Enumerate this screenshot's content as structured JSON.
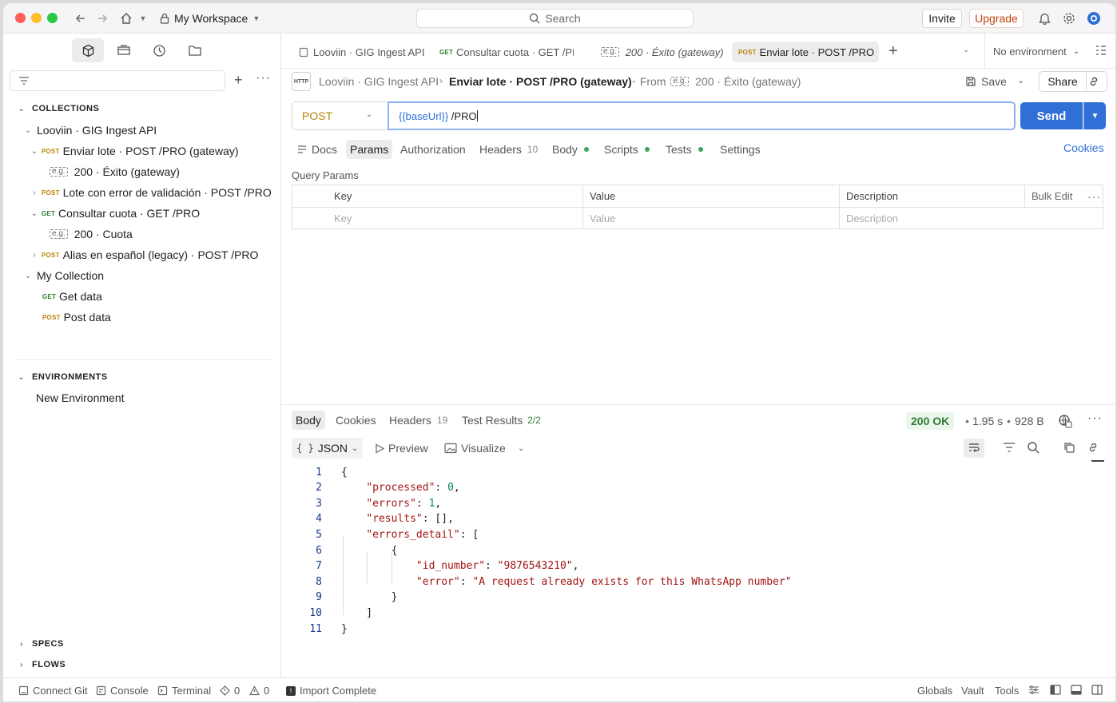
{
  "titlebar": {
    "workspace": "My Workspace",
    "search_placeholder": "Search",
    "invite_label": "Invite",
    "upgrade_label": "Upgrade"
  },
  "sidebar": {
    "collections_heading": "COLLECTIONS",
    "environments_heading": "ENVIRONMENTS",
    "specs_heading": "SPECS",
    "flows_heading": "FLOWS",
    "tree": [
      {
        "label": "Looviin · GIG Ingest API",
        "method": "",
        "kind": "collection"
      },
      {
        "label": "Enviar lote · POST /PRO (gateway)",
        "method": "POST",
        "kind": "request"
      },
      {
        "label": "200 · Éxito (gateway)",
        "method": "",
        "kind": "example"
      },
      {
        "label": "Lote con error de validación · POST /PRO",
        "method": "POST",
        "kind": "request"
      },
      {
        "label": "Consultar cuota · GET /PRO",
        "method": "GET",
        "kind": "request"
      },
      {
        "label": "200 · Cuota",
        "method": "",
        "kind": "example"
      },
      {
        "label": "Alias en español (legacy) · POST /PRO",
        "method": "POST",
        "kind": "request"
      },
      {
        "label": "My Collection",
        "method": "",
        "kind": "collection"
      },
      {
        "label": "Get data",
        "method": "GET",
        "kind": "request"
      },
      {
        "label": "Post data",
        "method": "POST",
        "kind": "request"
      }
    ],
    "environments": [
      "New Environment"
    ]
  },
  "tabs": [
    {
      "label": "Looviin · GIG Ingest API",
      "method": ""
    },
    {
      "label": "Consultar cuota · GET /PI",
      "method": "GET"
    },
    {
      "label": "200 · Éxito (gateway)",
      "method": ""
    },
    {
      "label": "Enviar lote · POST /PRO",
      "method": "POST"
    }
  ],
  "environment_selector": "No environment",
  "request": {
    "breadcrumb_collection": "Looviin · GIG Ingest API",
    "breadcrumb_request": "Enviar lote · POST /PRO (gateway)",
    "from_label": "From",
    "from_example": "200 · Éxito (gateway)",
    "save_label": "Save",
    "share_label": "Share",
    "method": "POST",
    "url_var": "{{baseUrl}}",
    "url_path": " /PRO",
    "send_label": "Send",
    "tabs": [
      {
        "label": "Docs"
      },
      {
        "label": "Params"
      },
      {
        "label": "Authorization"
      },
      {
        "label": "Headers",
        "count": "10"
      },
      {
        "label": "Body"
      },
      {
        "label": "Scripts"
      },
      {
        "label": "Tests"
      },
      {
        "label": "Settings"
      }
    ],
    "cookies_label": "Cookies",
    "query_params_title": "Query Params",
    "params_table": {
      "headers": [
        "Key",
        "Value",
        "Description"
      ],
      "bulk_edit": "Bulk Edit",
      "placeholders": [
        "Key",
        "Value",
        "Description"
      ]
    }
  },
  "response": {
    "tabs": [
      {
        "label": "Body"
      },
      {
        "label": "Cookies"
      },
      {
        "label": "Headers",
        "count": "19"
      },
      {
        "label": "Test Results",
        "count": "2/2"
      }
    ],
    "status": "200 OK",
    "time": "1.95 s",
    "size": "928 B",
    "format": "JSON",
    "preview_label": "Preview",
    "visualize_label": "Visualize",
    "code_lines": [
      "{",
      "    \"processed\": 0,",
      "    \"errors\": 1,",
      "    \"results\": [],",
      "    \"errors_detail\": [",
      "        {",
      "            \"id_number\": \"9876543210\",",
      "            \"error\": \"A request already exists for this WhatsApp number\"",
      "        }",
      "    ]",
      "}"
    ]
  },
  "statusbar": {
    "connect_git": "Connect Git",
    "console": "Console",
    "terminal": "Terminal",
    "errors_count": "0",
    "warnings_count": "0",
    "import_status": "Import Complete",
    "globals": "Globals",
    "vault": "Vault",
    "tools": "Tools"
  },
  "colors": {
    "accent": "#2f6fd6",
    "post": "#b8860b",
    "get": "#2e7d32",
    "upgrade": "#c2410c",
    "status_ok": "#2e7d32"
  }
}
